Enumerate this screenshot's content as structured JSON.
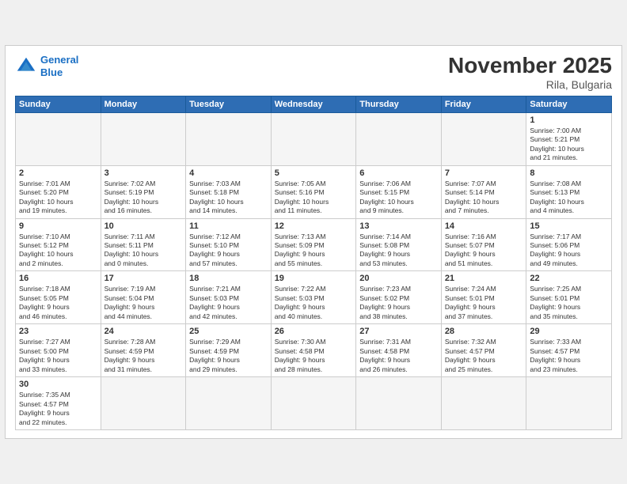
{
  "header": {
    "logo_general": "General",
    "logo_blue": "Blue",
    "title": "November 2025",
    "location": "Rila, Bulgaria"
  },
  "weekdays": [
    "Sunday",
    "Monday",
    "Tuesday",
    "Wednesday",
    "Thursday",
    "Friday",
    "Saturday"
  ],
  "weeks": [
    [
      {
        "day": "",
        "info": ""
      },
      {
        "day": "",
        "info": ""
      },
      {
        "day": "",
        "info": ""
      },
      {
        "day": "",
        "info": ""
      },
      {
        "day": "",
        "info": ""
      },
      {
        "day": "",
        "info": ""
      },
      {
        "day": "1",
        "info": "Sunrise: 7:00 AM\nSunset: 5:21 PM\nDaylight: 10 hours\nand 21 minutes."
      }
    ],
    [
      {
        "day": "2",
        "info": "Sunrise: 7:01 AM\nSunset: 5:20 PM\nDaylight: 10 hours\nand 19 minutes."
      },
      {
        "day": "3",
        "info": "Sunrise: 7:02 AM\nSunset: 5:19 PM\nDaylight: 10 hours\nand 16 minutes."
      },
      {
        "day": "4",
        "info": "Sunrise: 7:03 AM\nSunset: 5:18 PM\nDaylight: 10 hours\nand 14 minutes."
      },
      {
        "day": "5",
        "info": "Sunrise: 7:05 AM\nSunset: 5:16 PM\nDaylight: 10 hours\nand 11 minutes."
      },
      {
        "day": "6",
        "info": "Sunrise: 7:06 AM\nSunset: 5:15 PM\nDaylight: 10 hours\nand 9 minutes."
      },
      {
        "day": "7",
        "info": "Sunrise: 7:07 AM\nSunset: 5:14 PM\nDaylight: 10 hours\nand 7 minutes."
      },
      {
        "day": "8",
        "info": "Sunrise: 7:08 AM\nSunset: 5:13 PM\nDaylight: 10 hours\nand 4 minutes."
      }
    ],
    [
      {
        "day": "9",
        "info": "Sunrise: 7:10 AM\nSunset: 5:12 PM\nDaylight: 10 hours\nand 2 minutes."
      },
      {
        "day": "10",
        "info": "Sunrise: 7:11 AM\nSunset: 5:11 PM\nDaylight: 10 hours\nand 0 minutes."
      },
      {
        "day": "11",
        "info": "Sunrise: 7:12 AM\nSunset: 5:10 PM\nDaylight: 9 hours\nand 57 minutes."
      },
      {
        "day": "12",
        "info": "Sunrise: 7:13 AM\nSunset: 5:09 PM\nDaylight: 9 hours\nand 55 minutes."
      },
      {
        "day": "13",
        "info": "Sunrise: 7:14 AM\nSunset: 5:08 PM\nDaylight: 9 hours\nand 53 minutes."
      },
      {
        "day": "14",
        "info": "Sunrise: 7:16 AM\nSunset: 5:07 PM\nDaylight: 9 hours\nand 51 minutes."
      },
      {
        "day": "15",
        "info": "Sunrise: 7:17 AM\nSunset: 5:06 PM\nDaylight: 9 hours\nand 49 minutes."
      }
    ],
    [
      {
        "day": "16",
        "info": "Sunrise: 7:18 AM\nSunset: 5:05 PM\nDaylight: 9 hours\nand 46 minutes."
      },
      {
        "day": "17",
        "info": "Sunrise: 7:19 AM\nSunset: 5:04 PM\nDaylight: 9 hours\nand 44 minutes."
      },
      {
        "day": "18",
        "info": "Sunrise: 7:21 AM\nSunset: 5:03 PM\nDaylight: 9 hours\nand 42 minutes."
      },
      {
        "day": "19",
        "info": "Sunrise: 7:22 AM\nSunset: 5:03 PM\nDaylight: 9 hours\nand 40 minutes."
      },
      {
        "day": "20",
        "info": "Sunrise: 7:23 AM\nSunset: 5:02 PM\nDaylight: 9 hours\nand 38 minutes."
      },
      {
        "day": "21",
        "info": "Sunrise: 7:24 AM\nSunset: 5:01 PM\nDaylight: 9 hours\nand 37 minutes."
      },
      {
        "day": "22",
        "info": "Sunrise: 7:25 AM\nSunset: 5:01 PM\nDaylight: 9 hours\nand 35 minutes."
      }
    ],
    [
      {
        "day": "23",
        "info": "Sunrise: 7:27 AM\nSunset: 5:00 PM\nDaylight: 9 hours\nand 33 minutes."
      },
      {
        "day": "24",
        "info": "Sunrise: 7:28 AM\nSunset: 4:59 PM\nDaylight: 9 hours\nand 31 minutes."
      },
      {
        "day": "25",
        "info": "Sunrise: 7:29 AM\nSunset: 4:59 PM\nDaylight: 9 hours\nand 29 minutes."
      },
      {
        "day": "26",
        "info": "Sunrise: 7:30 AM\nSunset: 4:58 PM\nDaylight: 9 hours\nand 28 minutes."
      },
      {
        "day": "27",
        "info": "Sunrise: 7:31 AM\nSunset: 4:58 PM\nDaylight: 9 hours\nand 26 minutes."
      },
      {
        "day": "28",
        "info": "Sunrise: 7:32 AM\nSunset: 4:57 PM\nDaylight: 9 hours\nand 25 minutes."
      },
      {
        "day": "29",
        "info": "Sunrise: 7:33 AM\nSunset: 4:57 PM\nDaylight: 9 hours\nand 23 minutes."
      }
    ],
    [
      {
        "day": "30",
        "info": "Sunrise: 7:35 AM\nSunset: 4:57 PM\nDaylight: 9 hours\nand 22 minutes."
      },
      {
        "day": "",
        "info": ""
      },
      {
        "day": "",
        "info": ""
      },
      {
        "day": "",
        "info": ""
      },
      {
        "day": "",
        "info": ""
      },
      {
        "day": "",
        "info": ""
      },
      {
        "day": "",
        "info": ""
      }
    ]
  ]
}
